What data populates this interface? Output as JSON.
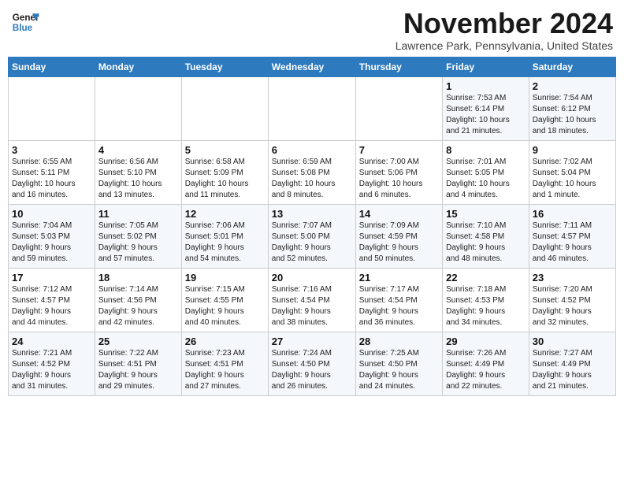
{
  "header": {
    "logo_line1": "General",
    "logo_line2": "Blue",
    "month": "November 2024",
    "location": "Lawrence Park, Pennsylvania, United States"
  },
  "weekdays": [
    "Sunday",
    "Monday",
    "Tuesday",
    "Wednesday",
    "Thursday",
    "Friday",
    "Saturday"
  ],
  "weeks": [
    [
      {
        "day": "",
        "info": ""
      },
      {
        "day": "",
        "info": ""
      },
      {
        "day": "",
        "info": ""
      },
      {
        "day": "",
        "info": ""
      },
      {
        "day": "",
        "info": ""
      },
      {
        "day": "1",
        "info": "Sunrise: 7:53 AM\nSunset: 6:14 PM\nDaylight: 10 hours\nand 21 minutes."
      },
      {
        "day": "2",
        "info": "Sunrise: 7:54 AM\nSunset: 6:12 PM\nDaylight: 10 hours\nand 18 minutes."
      }
    ],
    [
      {
        "day": "3",
        "info": "Sunrise: 6:55 AM\nSunset: 5:11 PM\nDaylight: 10 hours\nand 16 minutes."
      },
      {
        "day": "4",
        "info": "Sunrise: 6:56 AM\nSunset: 5:10 PM\nDaylight: 10 hours\nand 13 minutes."
      },
      {
        "day": "5",
        "info": "Sunrise: 6:58 AM\nSunset: 5:09 PM\nDaylight: 10 hours\nand 11 minutes."
      },
      {
        "day": "6",
        "info": "Sunrise: 6:59 AM\nSunset: 5:08 PM\nDaylight: 10 hours\nand 8 minutes."
      },
      {
        "day": "7",
        "info": "Sunrise: 7:00 AM\nSunset: 5:06 PM\nDaylight: 10 hours\nand 6 minutes."
      },
      {
        "day": "8",
        "info": "Sunrise: 7:01 AM\nSunset: 5:05 PM\nDaylight: 10 hours\nand 4 minutes."
      },
      {
        "day": "9",
        "info": "Sunrise: 7:02 AM\nSunset: 5:04 PM\nDaylight: 10 hours\nand 1 minute."
      }
    ],
    [
      {
        "day": "10",
        "info": "Sunrise: 7:04 AM\nSunset: 5:03 PM\nDaylight: 9 hours\nand 59 minutes."
      },
      {
        "day": "11",
        "info": "Sunrise: 7:05 AM\nSunset: 5:02 PM\nDaylight: 9 hours\nand 57 minutes."
      },
      {
        "day": "12",
        "info": "Sunrise: 7:06 AM\nSunset: 5:01 PM\nDaylight: 9 hours\nand 54 minutes."
      },
      {
        "day": "13",
        "info": "Sunrise: 7:07 AM\nSunset: 5:00 PM\nDaylight: 9 hours\nand 52 minutes."
      },
      {
        "day": "14",
        "info": "Sunrise: 7:09 AM\nSunset: 4:59 PM\nDaylight: 9 hours\nand 50 minutes."
      },
      {
        "day": "15",
        "info": "Sunrise: 7:10 AM\nSunset: 4:58 PM\nDaylight: 9 hours\nand 48 minutes."
      },
      {
        "day": "16",
        "info": "Sunrise: 7:11 AM\nSunset: 4:57 PM\nDaylight: 9 hours\nand 46 minutes."
      }
    ],
    [
      {
        "day": "17",
        "info": "Sunrise: 7:12 AM\nSunset: 4:57 PM\nDaylight: 9 hours\nand 44 minutes."
      },
      {
        "day": "18",
        "info": "Sunrise: 7:14 AM\nSunset: 4:56 PM\nDaylight: 9 hours\nand 42 minutes."
      },
      {
        "day": "19",
        "info": "Sunrise: 7:15 AM\nSunset: 4:55 PM\nDaylight: 9 hours\nand 40 minutes."
      },
      {
        "day": "20",
        "info": "Sunrise: 7:16 AM\nSunset: 4:54 PM\nDaylight: 9 hours\nand 38 minutes."
      },
      {
        "day": "21",
        "info": "Sunrise: 7:17 AM\nSunset: 4:54 PM\nDaylight: 9 hours\nand 36 minutes."
      },
      {
        "day": "22",
        "info": "Sunrise: 7:18 AM\nSunset: 4:53 PM\nDaylight: 9 hours\nand 34 minutes."
      },
      {
        "day": "23",
        "info": "Sunrise: 7:20 AM\nSunset: 4:52 PM\nDaylight: 9 hours\nand 32 minutes."
      }
    ],
    [
      {
        "day": "24",
        "info": "Sunrise: 7:21 AM\nSunset: 4:52 PM\nDaylight: 9 hours\nand 31 minutes."
      },
      {
        "day": "25",
        "info": "Sunrise: 7:22 AM\nSunset: 4:51 PM\nDaylight: 9 hours\nand 29 minutes."
      },
      {
        "day": "26",
        "info": "Sunrise: 7:23 AM\nSunset: 4:51 PM\nDaylight: 9 hours\nand 27 minutes."
      },
      {
        "day": "27",
        "info": "Sunrise: 7:24 AM\nSunset: 4:50 PM\nDaylight: 9 hours\nand 26 minutes."
      },
      {
        "day": "28",
        "info": "Sunrise: 7:25 AM\nSunset: 4:50 PM\nDaylight: 9 hours\nand 24 minutes."
      },
      {
        "day": "29",
        "info": "Sunrise: 7:26 AM\nSunset: 4:49 PM\nDaylight: 9 hours\nand 22 minutes."
      },
      {
        "day": "30",
        "info": "Sunrise: 7:27 AM\nSunset: 4:49 PM\nDaylight: 9 hours\nand 21 minutes."
      }
    ]
  ]
}
